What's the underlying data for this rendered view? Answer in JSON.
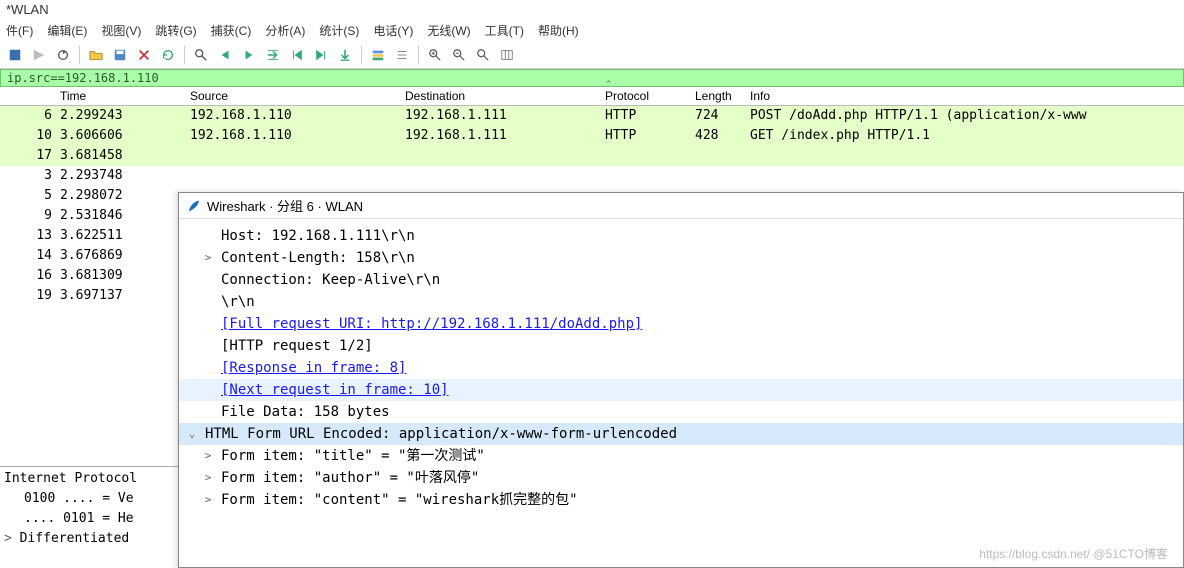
{
  "title": "*WLAN",
  "menu": {
    "file": "件(F)",
    "edit": "编辑(E)",
    "view": "视图(V)",
    "goto": "跳转(G)",
    "capture": "捕获(C)",
    "analyze": "分析(A)",
    "stats": "统计(S)",
    "telephony": "电话(Y)",
    "wireless": "无线(W)",
    "tools": "工具(T)",
    "help": "帮助(H)"
  },
  "filter": "ip.src==192.168.1.110",
  "columns": {
    "no": "",
    "time": "Time",
    "source": "Source",
    "destination": "Destination",
    "protocol": "Protocol",
    "length": "Length",
    "info": "Info"
  },
  "packets": [
    {
      "no": "6",
      "time": "2.299243",
      "src": "192.168.1.110",
      "dst": "192.168.1.111",
      "proto": "HTTP",
      "len": "724",
      "info": "POST /doAdd.php HTTP/1.1  (application/x-www",
      "green": true
    },
    {
      "no": "10",
      "time": "3.606606",
      "src": "192.168.1.110",
      "dst": "192.168.1.111",
      "proto": "HTTP",
      "len": "428",
      "info": "GET /index.php HTTP/1.1",
      "green": true
    },
    {
      "no": "17",
      "time": "3.681458",
      "src": "",
      "dst": "",
      "proto": "",
      "len": "",
      "info": "",
      "green": true
    },
    {
      "no": "3",
      "time": "2.293748",
      "src": "",
      "dst": "",
      "proto": "",
      "len": "",
      "info": "",
      "green": false
    },
    {
      "no": "5",
      "time": "2.298072",
      "src": "",
      "dst": "",
      "proto": "",
      "len": "",
      "info": "",
      "green": false
    },
    {
      "no": "9",
      "time": "2.531846",
      "src": "",
      "dst": "",
      "proto": "",
      "len": "",
      "info": "",
      "green": false
    },
    {
      "no": "13",
      "time": "3.622511",
      "src": "",
      "dst": "",
      "proto": "",
      "len": "",
      "info": "",
      "green": false
    },
    {
      "no": "14",
      "time": "3.676869",
      "src": "",
      "dst": "",
      "proto": "",
      "len": "",
      "info": "",
      "green": false
    },
    {
      "no": "16",
      "time": "3.681309",
      "src": "",
      "dst": "",
      "proto": "",
      "len": "",
      "info": "",
      "green": false
    },
    {
      "no": "19",
      "time": "3.697137",
      "src": "",
      "dst": "",
      "proto": "",
      "len": "",
      "info": "",
      "green": false
    }
  ],
  "details_title": "Wireshark · 分组 6 · WLAN",
  "details": {
    "l0": "Host: 192.168.1.111\\r\\n",
    "l1": "Content-Length: 158\\r\\n",
    "l2": "Connection: Keep-Alive\\r\\n",
    "l3": "\\r\\n",
    "l4": "[Full request URI: http://192.168.1.111/doAdd.php]",
    "l5": "[HTTP request 1/2]",
    "l6": "[Response in frame: 8]",
    "l7": "[Next request in frame: 10]",
    "l8": "File Data: 158 bytes",
    "l9": "HTML Form URL Encoded: application/x-www-form-urlencoded",
    "l10": "Form item: \"title\" = \"第一次测试\"",
    "l11": "Form item: \"author\" = \"叶落风停\"",
    "l12": "Form item: \"content\" = \"wireshark抓完整的包\""
  },
  "bottom_left": {
    "l0": "Internet Protocol",
    "l1": "0100 .... = Ve",
    "l2": ".... 0101 = He",
    "l3": "Differentiated"
  },
  "watermark": "https://blog.csdn.net/   @51CTO博客"
}
